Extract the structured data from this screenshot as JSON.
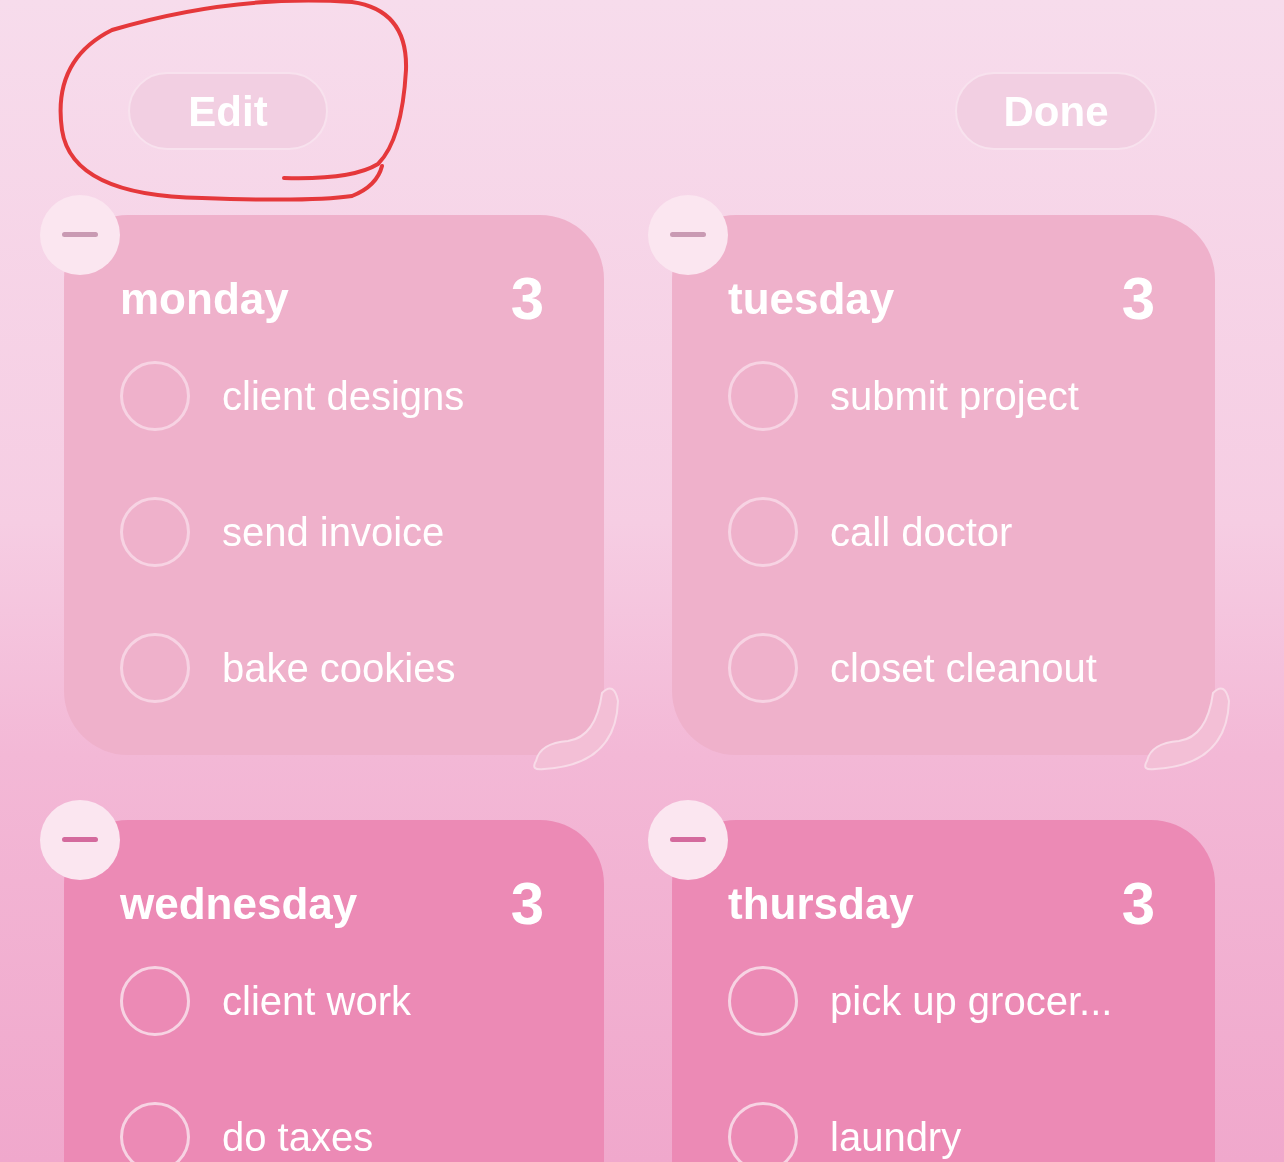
{
  "toolbar": {
    "left_button": "Edit",
    "right_button": "Done"
  },
  "widgets": [
    {
      "title": "monday",
      "count": "3",
      "tasks": [
        {
          "text": "client designs",
          "checked": false
        },
        {
          "text": "send invoice",
          "checked": false
        },
        {
          "text": "bake cookies",
          "checked": false
        }
      ]
    },
    {
      "title": "tuesday",
      "count": "3",
      "tasks": [
        {
          "text": "submit project",
          "checked": false
        },
        {
          "text": "call doctor",
          "checked": false
        },
        {
          "text": "closet cleanout",
          "checked": false
        }
      ]
    },
    {
      "title": "wednesday",
      "count": "3",
      "tasks": [
        {
          "text": "client work",
          "checked": false
        },
        {
          "text": "do taxes",
          "checked": false
        }
      ]
    },
    {
      "title": "thursday",
      "count": "3",
      "tasks": [
        {
          "text": "pick up grocer...",
          "checked": false
        },
        {
          "text": "laundry",
          "checked": false
        }
      ]
    }
  ]
}
